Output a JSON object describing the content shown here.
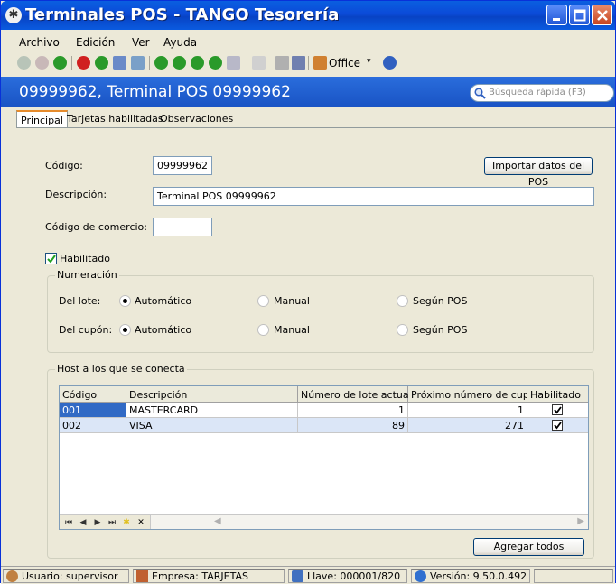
{
  "window": {
    "title": "Terminales POS - TANGO Tesorería"
  },
  "menu": {
    "items": [
      "Archivo",
      "Edición",
      "Ver",
      "Ayuda"
    ]
  },
  "toolbar": {
    "office_label": "Office"
  },
  "header": {
    "title": "09999962, Terminal POS 09999962",
    "search_placeholder": "Búsqueda rápida (F3)"
  },
  "tabs": [
    {
      "label": "Principal",
      "active": true
    },
    {
      "label": "Tarjetas habilitadas",
      "active": false
    },
    {
      "label": "Observaciones",
      "active": false
    }
  ],
  "form": {
    "codigo_label": "Código:",
    "codigo_value": "09999962",
    "import_button": "Importar datos del POS",
    "descripcion_label": "Descripción:",
    "descripcion_value": "Terminal POS 09999962",
    "comercio_label": "Código de comercio:",
    "comercio_value": "",
    "habilitado_label": "Habilitado",
    "habilitado_checked": true
  },
  "numeracion": {
    "legend": "Numeración",
    "lote": {
      "label": "Del lote:",
      "options": [
        "Automático",
        "Manual",
        "Según POS"
      ],
      "selected": "Automático"
    },
    "cupon": {
      "label": "Del cupón:",
      "options": [
        "Automático",
        "Manual",
        "Según POS"
      ],
      "selected": "Automático"
    }
  },
  "hosts": {
    "legend": "Host a los que se conecta",
    "columns": [
      "Código",
      "Descripción",
      "Número de lote actual",
      "Próximo número de cupón",
      "Habilitado"
    ],
    "rows": [
      {
        "codigo": "001",
        "descripcion": "MASTERCARD",
        "lote": "1",
        "cupon": "1",
        "habilitado": true
      },
      {
        "codigo": "002",
        "descripcion": "VISA",
        "lote": "89",
        "cupon": "271",
        "habilitado": true
      }
    ],
    "add_all_button": "Agregar todos"
  },
  "status": {
    "usuario": "Usuario: supervisor",
    "empresa": "Empresa: TARJETAS",
    "llave": "Llave: 000001/820",
    "version": "Versión: 9.50.0.492"
  },
  "colors": {
    "accent": "#1953c4",
    "title_bar": "#0a5be0",
    "row_selected": "#dbe6f7"
  }
}
